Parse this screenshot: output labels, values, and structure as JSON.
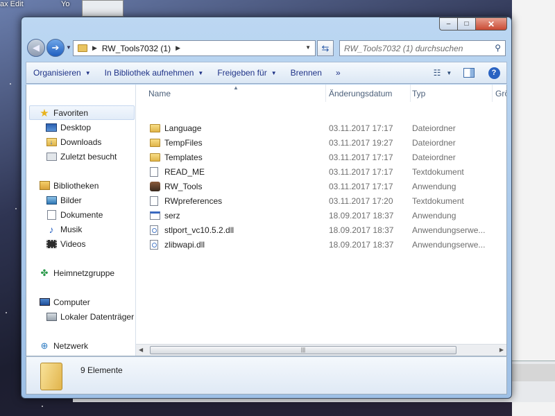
{
  "background": {
    "texts": [
      "ax Edit",
      "Yo"
    ]
  },
  "window": {
    "caption": {
      "minimize": "–",
      "maximize": "□",
      "close": "✕"
    }
  },
  "nav": {
    "back": "◀",
    "forward": "➔",
    "address_segments": [
      "RW_Tools7032 (1)"
    ],
    "search_placeholder": "RW_Tools7032 (1) durchsuchen"
  },
  "toolbar": {
    "organize": "Organisieren",
    "include_library": "In Bibliothek aufnehmen",
    "share": "Freigeben für",
    "burn": "Brennen",
    "more": "»"
  },
  "sidebar": {
    "groups": [
      {
        "label": "Favoriten",
        "items": [
          "Desktop",
          "Downloads",
          "Zuletzt besucht"
        ]
      },
      {
        "label": "Bibliotheken",
        "items": [
          "Bilder",
          "Dokumente",
          "Musik",
          "Videos"
        ]
      },
      {
        "label": "Heimnetzgruppe",
        "items": []
      },
      {
        "label": "Computer",
        "items": [
          "Lokaler Datenträger"
        ]
      },
      {
        "label": "Netzwerk",
        "items": []
      }
    ]
  },
  "columns": {
    "name": "Name",
    "date": "Änderungsdatum",
    "type": "Typ",
    "size": "Grö"
  },
  "files": [
    {
      "name": "Language",
      "date": "03.11.2017 17:17",
      "type": "Dateiordner",
      "icon": "folder-icon"
    },
    {
      "name": "TempFiles",
      "date": "03.11.2017 19:27",
      "type": "Dateiordner",
      "icon": "folder-icon"
    },
    {
      "name": "Templates",
      "date": "03.11.2017 17:17",
      "type": "Dateiordner",
      "icon": "folder-icon"
    },
    {
      "name": "READ_ME",
      "date": "03.11.2017 17:17",
      "type": "Textdokument",
      "icon": "text-file-icon"
    },
    {
      "name": "RW_Tools",
      "date": "03.11.2017 17:17",
      "type": "Anwendung",
      "icon": "application-icon"
    },
    {
      "name": "RWpreferences",
      "date": "03.11.2017 17:20",
      "type": "Textdokument",
      "icon": "text-file-icon"
    },
    {
      "name": "serz",
      "date": "18.09.2017 18:37",
      "type": "Anwendung",
      "icon": "executable-icon"
    },
    {
      "name": "stlport_vc10.5.2.dll",
      "date": "18.09.2017 18:37",
      "type": "Anwendungserwe...",
      "icon": "dll-file-icon"
    },
    {
      "name": "zlibwapi.dll",
      "date": "18.09.2017 18:37",
      "type": "Anwendungserwe...",
      "icon": "dll-file-icon"
    }
  ],
  "details": {
    "count": "9 Elemente"
  }
}
